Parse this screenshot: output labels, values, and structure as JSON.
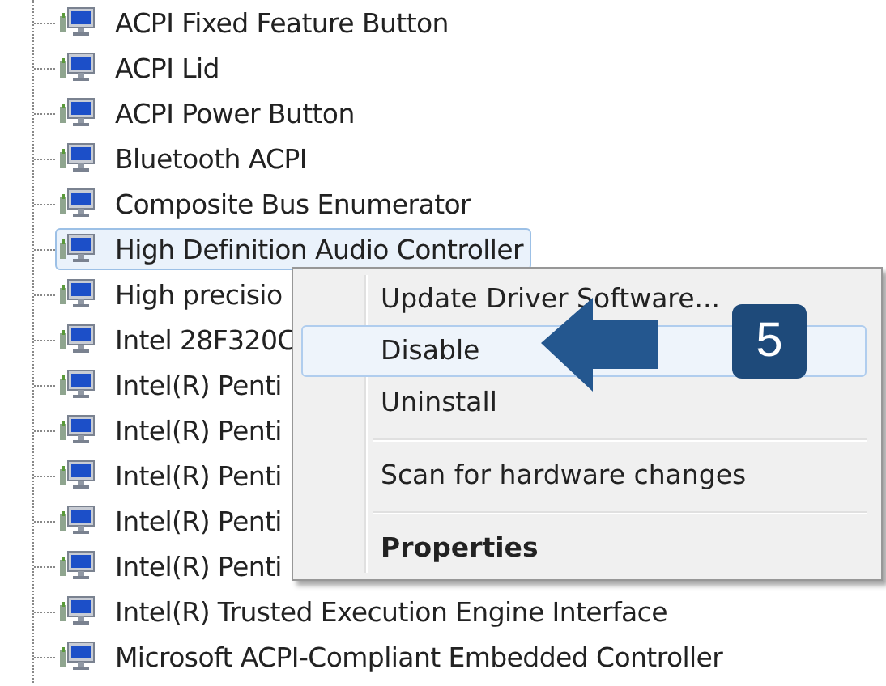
{
  "tree": {
    "items": [
      {
        "label": "ACPI Fixed Feature Button",
        "selected": false
      },
      {
        "label": "ACPI Lid",
        "selected": false
      },
      {
        "label": "ACPI Power Button",
        "selected": false
      },
      {
        "label": "Bluetooth ACPI",
        "selected": false
      },
      {
        "label": "Composite Bus Enumerator",
        "selected": false
      },
      {
        "label": "High Definition Audio Controller",
        "selected": true
      },
      {
        "label": "High precisio",
        "selected": false
      },
      {
        "label": "Intel 28F320C",
        "selected": false
      },
      {
        "label": "Intel(R) Penti",
        "selected": false
      },
      {
        "label": "Intel(R) Penti",
        "selected": false
      },
      {
        "label": "Intel(R) Penti",
        "selected": false
      },
      {
        "label": "Intel(R) Penti",
        "selected": false
      },
      {
        "label": "Intel(R) Penti",
        "selected": false
      },
      {
        "label": "Intel(R) Trusted Execution Engine Interface",
        "selected": false
      },
      {
        "label": "Microsoft ACPI-Compliant Embedded Controller",
        "selected": false
      }
    ]
  },
  "context_menu": {
    "items": [
      {
        "kind": "item",
        "label": "Update Driver Software...",
        "highlighted": false,
        "default": false
      },
      {
        "kind": "item",
        "label": "Disable",
        "highlighted": true,
        "default": false
      },
      {
        "kind": "item",
        "label": "Uninstall",
        "highlighted": false,
        "default": false
      },
      {
        "kind": "separator"
      },
      {
        "kind": "item",
        "label": "Scan for hardware changes",
        "highlighted": false,
        "default": false
      },
      {
        "kind": "separator"
      },
      {
        "kind": "item",
        "label": "Properties",
        "highlighted": false,
        "default": true
      }
    ]
  },
  "callout": {
    "number": "5"
  }
}
